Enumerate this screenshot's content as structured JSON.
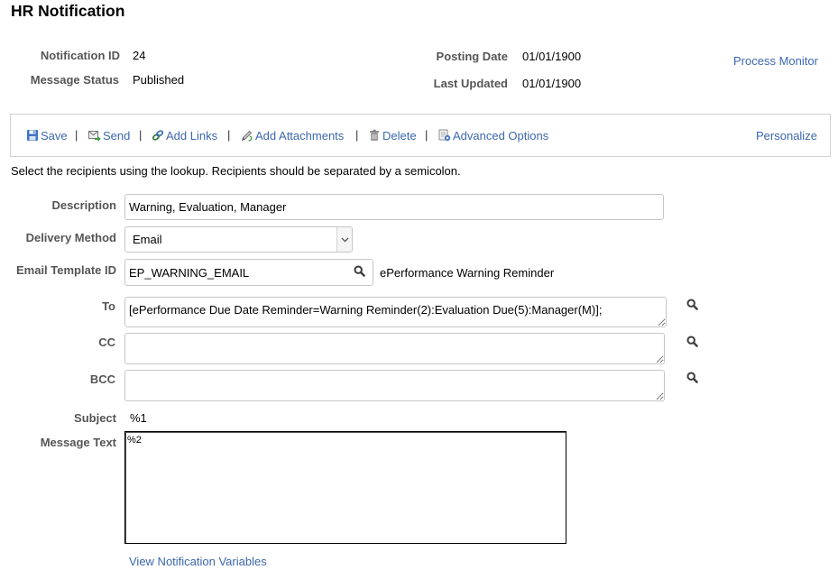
{
  "page": {
    "title": "HR Notification"
  },
  "header": {
    "notification_id": {
      "label": "Notification ID",
      "value": "24"
    },
    "message_status": {
      "label": "Message Status",
      "value": "Published"
    },
    "posting_date": {
      "label": "Posting Date",
      "value": "01/01/1900"
    },
    "last_updated": {
      "label": "Last Updated",
      "value": "01/01/1900"
    },
    "process_monitor": {
      "label": "Process Monitor"
    }
  },
  "toolbar": {
    "separator": "|",
    "items": [
      {
        "label": "Save",
        "icon": "save-icon"
      },
      {
        "label": "Send",
        "icon": "send-icon"
      },
      {
        "label": "Add Links",
        "icon": "add-links-icon"
      },
      {
        "label": "Add Attachments",
        "icon": "add-attachments-icon"
      },
      {
        "label": "Delete",
        "icon": "delete-icon"
      },
      {
        "label": "Advanced Options",
        "icon": "advanced-options-icon"
      }
    ],
    "personalize": "Personalize"
  },
  "instructions": "Select the recipients using the lookup. Recipients should be separated by a semicolon.",
  "form": {
    "description": {
      "label": "Description",
      "value": "Warning, Evaluation, Manager"
    },
    "delivery_method": {
      "label": "Delivery Method",
      "value": "Email",
      "icon": "chevron-down-icon"
    },
    "email_template": {
      "label": "Email Template ID",
      "value": "EP_WARNING_EMAIL",
      "template_name": "ePerformance Warning Reminder",
      "icon": "search-icon"
    },
    "to": {
      "label": "To",
      "value": "[ePerformance Due Date Reminder=Warning Reminder(2):Evaluation Due(5):Manager(M)];",
      "icon": "search-icon"
    },
    "cc": {
      "label": "CC",
      "value": "",
      "icon": "search-icon"
    },
    "bcc": {
      "label": "BCC",
      "value": "",
      "icon": "search-icon"
    },
    "subject": {
      "label": "Subject",
      "value": "%1"
    },
    "message_text": {
      "label": "Message Text",
      "value": "%2"
    }
  },
  "footer": {
    "view_variables_link": "View Notification Variables"
  },
  "colors": {
    "link": "#3b67b0",
    "label": "#555555",
    "text": "#000000",
    "field_border": "#c6c6c6"
  }
}
